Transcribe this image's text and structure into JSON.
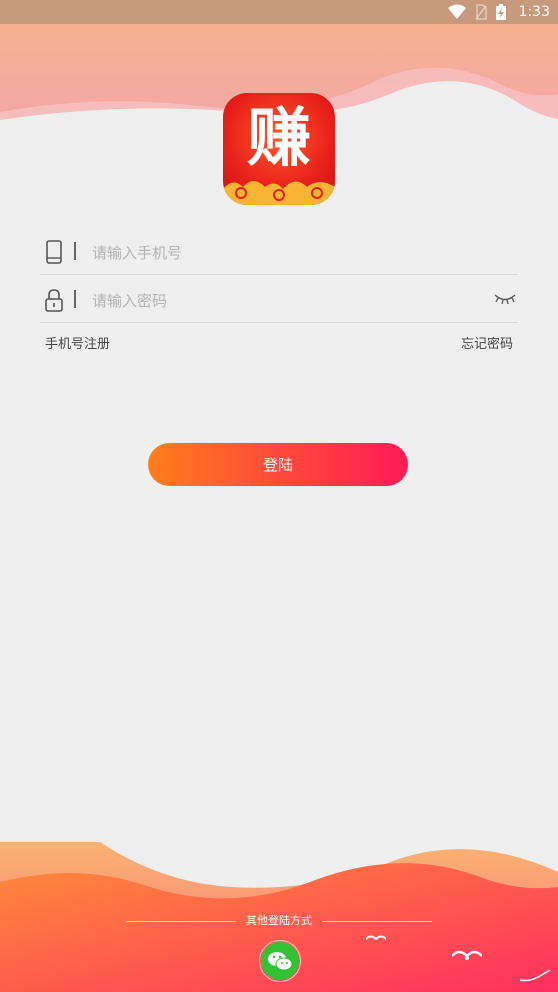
{
  "status_bar": {
    "time": "1:33",
    "icons": [
      "wifi-icon",
      "no-sim-icon",
      "battery-charging-icon"
    ]
  },
  "logo": {
    "glyph": "赚"
  },
  "form": {
    "phone_placeholder": "请输入手机号",
    "password_placeholder": "请输入密码"
  },
  "links": {
    "register": "手机号注册",
    "forgot_password": "忘记密码"
  },
  "login_button": "登陆",
  "other_login": {
    "label": "其他登陆方式",
    "options": [
      "wechat-icon"
    ]
  },
  "colors": {
    "status_bar": "#c79a7e",
    "button_start": "#ff7e1c",
    "button_end": "#ff1b56",
    "background": "#efefef",
    "wechat_green": "#33c233"
  }
}
